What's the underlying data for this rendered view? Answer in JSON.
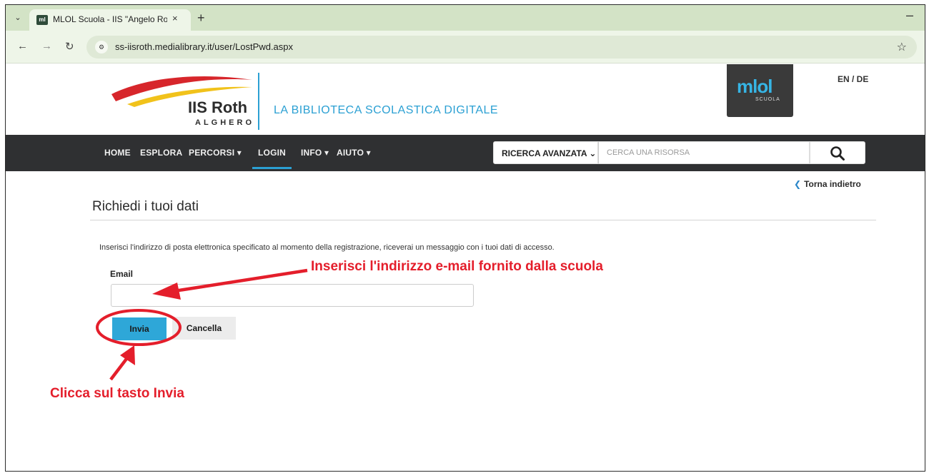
{
  "browser": {
    "tab_title": "MLOL Scuola - IIS \"Angelo Roth",
    "tab_favicon_text": "ml",
    "url": "ss-iisroth.medialibrary.it/user/LostPwd.aspx",
    "menu_glyph": "⌄",
    "close_glyph": "×",
    "new_tab_glyph": "+",
    "minimize_glyph": "–",
    "back_glyph": "←",
    "forward_glyph": "→",
    "reload_glyph": "↻",
    "site_info_glyph": "⚙",
    "bookmark_glyph": "☆"
  },
  "header": {
    "school_name": "IIS Roth",
    "school_city": "ALGHERO",
    "library_title": "LA BIBLIOTECA SCOLASTICA DIGITALE",
    "mlol_logo_text": "mlol",
    "mlol_logo_sub": "SCUOLA",
    "language_switch": "EN / DE",
    "colors": {
      "swoosh_red": "#d7262b",
      "swoosh_yellow": "#f1c21b",
      "accent_blue": "#2ba0d3"
    }
  },
  "nav": {
    "items": [
      {
        "label": "HOME"
      },
      {
        "label": "ESPLORA"
      },
      {
        "label": "PERCORSI ▾"
      },
      {
        "label": "LOGIN"
      },
      {
        "label": "INFO ▾"
      },
      {
        "label": "AIUTO ▾"
      }
    ],
    "advanced_search": "RICERCA AVANZATA ⌄",
    "search_placeholder": "CERCA UNA RISORSA",
    "search_icon": "search-icon"
  },
  "content": {
    "back_chevron": "❮",
    "back_label": "Torna indietro",
    "page_title": "Richiedi i tuoi dati",
    "intro": "Inserisci l'indirizzo di posta elettronica specificato al momento della registrazione, riceverai un messaggio con i tuoi dati di accesso.",
    "email_label": "Email",
    "email_value": "",
    "submit_label": "Invia",
    "cancel_label": "Cancella"
  },
  "annotations": {
    "email_hint": "Inserisci l'indirizzo e-mail fornito dalla scuola",
    "submit_hint": "Clicca sul tasto Invia",
    "color": "#e41e2b"
  }
}
